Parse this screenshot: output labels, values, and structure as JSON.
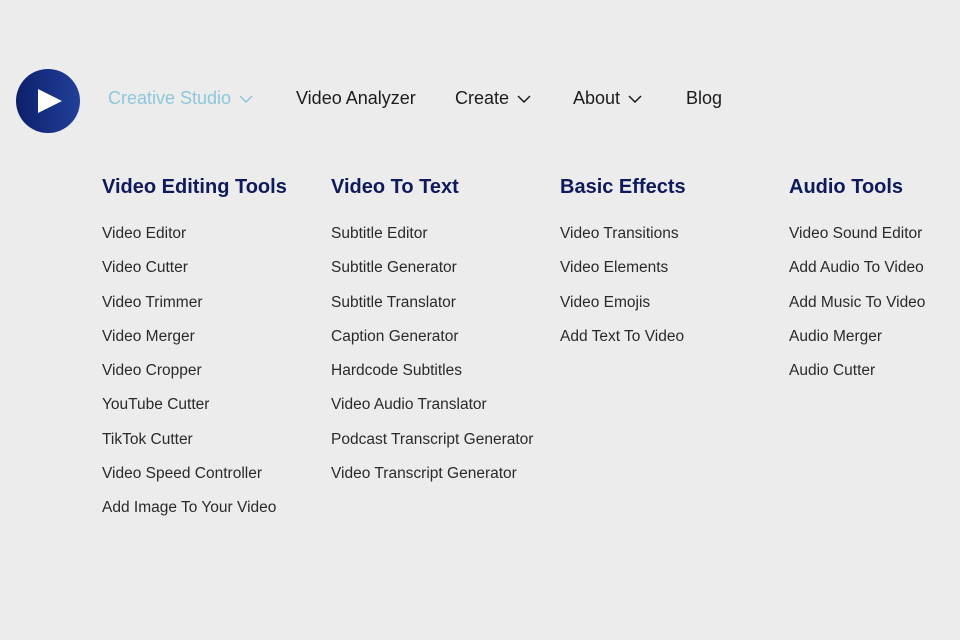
{
  "nav": {
    "items": [
      {
        "label": "Creative Studio",
        "dropdown": true,
        "active": true
      },
      {
        "label": "Video Analyzer",
        "dropdown": false
      },
      {
        "label": "Create",
        "dropdown": true
      },
      {
        "label": "About",
        "dropdown": true
      },
      {
        "label": "Blog",
        "dropdown": false
      }
    ]
  },
  "menu": {
    "columns": [
      {
        "title": "Video Editing Tools",
        "links": [
          "Video Editor",
          "Video Cutter",
          "Video Trimmer",
          "Video Merger",
          "Video Cropper",
          "YouTube Cutter",
          "TikTok Cutter",
          "Video Speed Controller",
          "Add Image To Your Video"
        ]
      },
      {
        "title": "Video To Text",
        "links": [
          "Subtitle Editor",
          "Subtitle Generator",
          "Subtitle Translator",
          "Caption Generator",
          "Hardcode Subtitles",
          "Video Audio Translator",
          "Podcast Transcript Generator",
          "Video Transcript Generator"
        ]
      },
      {
        "title": "Basic Effects",
        "links": [
          "Video Transitions",
          "Video Elements",
          "Video Emojis",
          "Add Text To Video"
        ]
      },
      {
        "title": "Audio Tools",
        "links": [
          "Video Sound Editor",
          "Add Audio To Video",
          "Add Music To Video",
          "Audio Merger",
          "Audio Cutter"
        ]
      }
    ]
  },
  "colors": {
    "accent": "#8cc8da",
    "heading": "#0f1a5a",
    "logo": "#1a2f85"
  }
}
